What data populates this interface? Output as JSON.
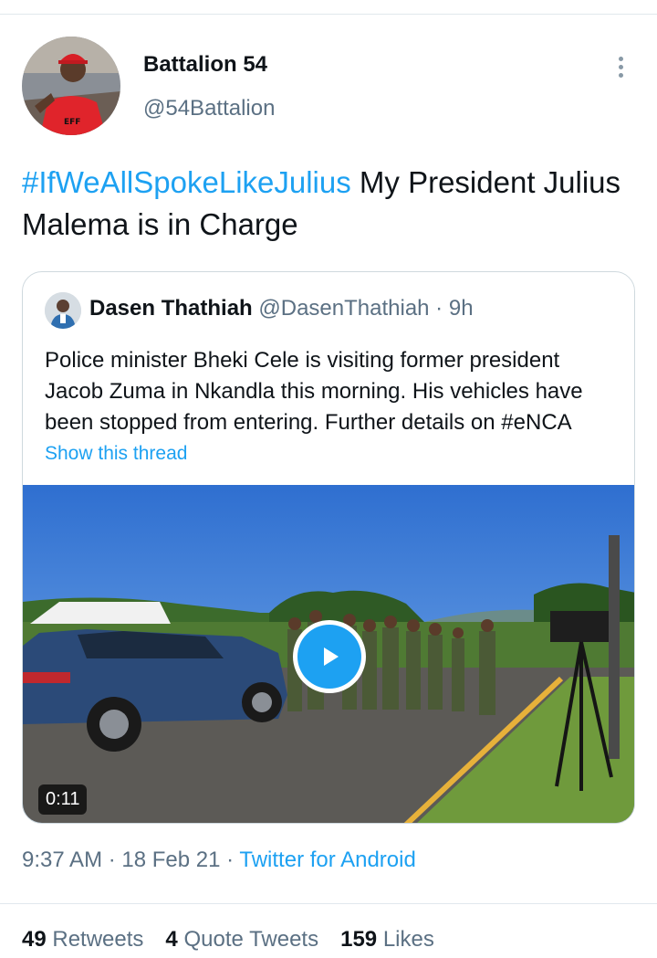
{
  "tweet": {
    "author": {
      "name": "Battalion 54",
      "handle": "@54Battalion"
    },
    "text": {
      "hashtag": "#IfWeAllSpokeLikeJulius",
      "body": " My President Julius Malema is in Charge"
    },
    "meta": {
      "time": "9:37 AM",
      "sep1": " · ",
      "date": "18 Feb 21",
      "sep2": " · ",
      "source": "Twitter for Android"
    },
    "stats": {
      "retweets": {
        "count": "49",
        "label": "Retweets"
      },
      "quote_tweets": {
        "count": "4",
        "label": "Quote Tweets"
      },
      "likes": {
        "count": "159",
        "label": "Likes"
      }
    }
  },
  "quoted": {
    "name": "Dasen Thathiah",
    "handle": "@DasenThathiah",
    "dot": " · ",
    "time": "9h",
    "text": "Police minister Bheki Cele is visiting former president Jacob Zuma in Nkandla this morning. His vehicles have been stopped from entering. Further details on #eNCA",
    "show_thread": "Show this thread",
    "media": {
      "type": "video",
      "duration": "0:11"
    }
  },
  "colors": {
    "accent": "#1da1f2",
    "secondary_text": "#5b7083",
    "primary_text": "#0f1419",
    "border": "#cfd9de"
  },
  "icons": {
    "more": "more-vertical-icon",
    "play": "play-icon"
  }
}
